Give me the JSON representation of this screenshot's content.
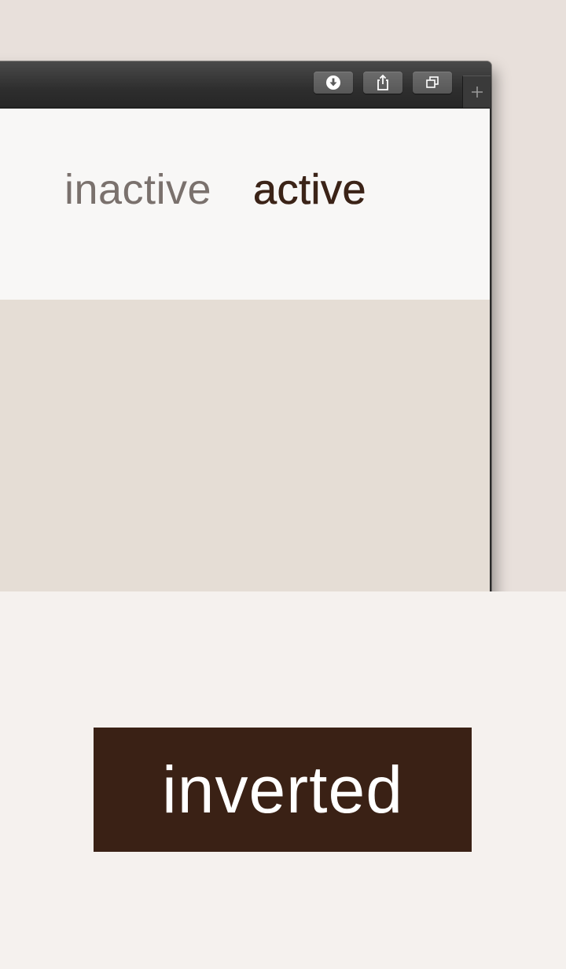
{
  "toolbar": {
    "buttons": [
      {
        "name": "download",
        "icon": "download-icon"
      },
      {
        "name": "share",
        "icon": "share-icon"
      },
      {
        "name": "tabs",
        "icon": "tabs-overview-icon"
      }
    ],
    "new_tab_label": "+"
  },
  "nav": {
    "inactive_label": "inactive",
    "active_label": "active"
  },
  "showcase": {
    "inverted_label": "inverted"
  },
  "colors": {
    "backdrop": "#e8e0db",
    "page_background": "#f5f1ee",
    "nav_background": "#f8f7f6",
    "content_background": "#e5ddd5",
    "inactive_text": "#7a716d",
    "active_text": "#3b2317",
    "inverted_background": "#3a2115",
    "inverted_text": "#ffffff"
  }
}
